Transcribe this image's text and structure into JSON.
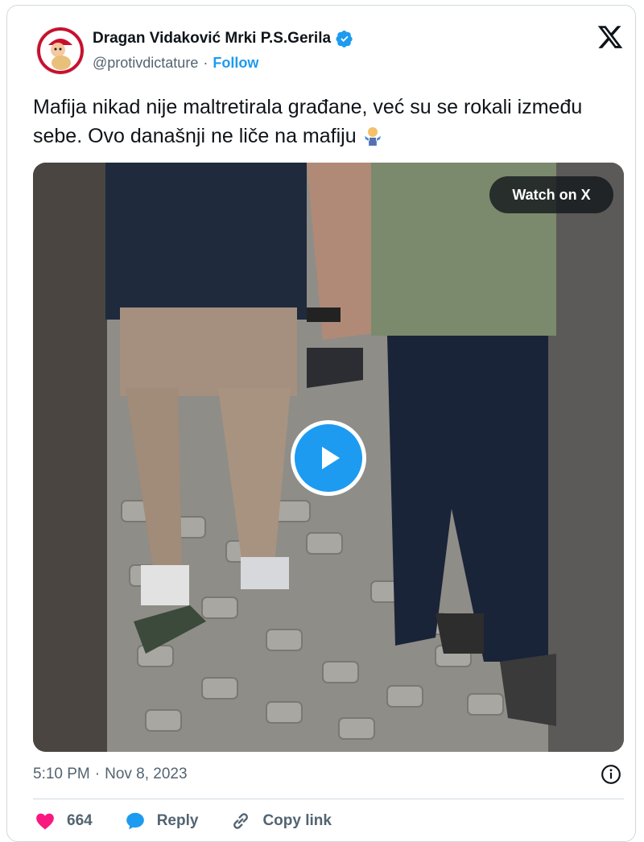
{
  "author": {
    "name": "Dragan Vidaković Mrki P.S.Gerila",
    "handle": "@protivdictature",
    "separator": "·",
    "follow_label": "Follow"
  },
  "icons": {
    "verified": "verified-badge-icon",
    "logo": "x-logo-icon",
    "info": "info-icon",
    "like": "heart-icon",
    "reply": "reply-bubble-icon",
    "copy": "link-icon",
    "emoji": "man-shrugging-emoji"
  },
  "tweet": {
    "text": "Mafija nikad nije maltretirala građane, već su se rokali između sebe. Ovo današnji ne liče na mafiju"
  },
  "media": {
    "watch_label": "Watch on X",
    "type": "video"
  },
  "meta": {
    "time": "5:10 PM",
    "separator": "·",
    "date": "Nov 8, 2023"
  },
  "actions": {
    "likes": "664",
    "reply_label": "Reply",
    "copy_label": "Copy link"
  },
  "colors": {
    "accent": "#1d9bf0",
    "like": "#f91880",
    "text": "#0f1419",
    "muted": "#536471"
  }
}
